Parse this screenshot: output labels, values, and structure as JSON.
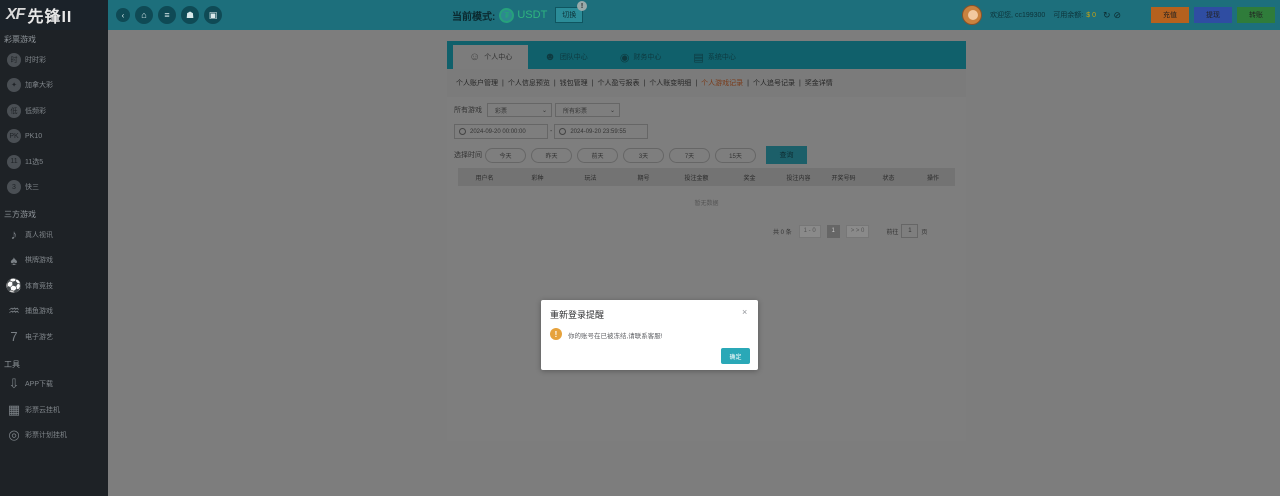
{
  "brand": {
    "logo_mark": "XF",
    "name": "先锋II"
  },
  "topbar": {
    "nav_icons": [
      "back-icon",
      "home-icon",
      "menu-icon",
      "account-icon",
      "gift-icon"
    ],
    "mode_label": "当前模式:",
    "mode_value": "USDT",
    "switch_label": "切换",
    "notice_badge": "!",
    "welcome": "欢迎您,",
    "username": "cc199300",
    "balance_label": "可用余额:",
    "balance_value": "$ 0",
    "recharge_label": "充值",
    "withdraw_label": "提现",
    "transfer_label": "转账",
    "colors": {
      "bar": "#1d6f7c",
      "recharge": "#b5611e",
      "withdraw": "#2f4da2",
      "transfer": "#2f7c3a"
    }
  },
  "sidebar": {
    "sections": [
      {
        "title": "彩票游戏",
        "items": [
          {
            "icon": "clock-icon",
            "glyph": "时",
            "label": "时时彩"
          },
          {
            "icon": "maple-leaf-icon",
            "glyph": "✦",
            "label": "加拿大彩"
          },
          {
            "icon": "low-freq-icon",
            "glyph": "低",
            "label": "低频彩"
          },
          {
            "icon": "pk10-icon",
            "glyph": "PK",
            "label": "PK10"
          },
          {
            "icon": "11x5-icon",
            "glyph": "11",
            "label": "11选5"
          },
          {
            "icon": "k3-icon",
            "glyph": "3",
            "label": "快三"
          }
        ]
      },
      {
        "title": "三方游戏",
        "items": [
          {
            "icon": "live-casino-icon",
            "glyph": "♪",
            "label": "真人视讯"
          },
          {
            "icon": "cards-icon",
            "glyph": "♠",
            "label": "棋牌游戏"
          },
          {
            "icon": "soccer-icon",
            "glyph": "⚽",
            "label": "体育竞技"
          },
          {
            "icon": "fish-icon",
            "glyph": "♒",
            "label": "捕鱼游戏"
          },
          {
            "icon": "slot-icon",
            "glyph": "7",
            "label": "电子游艺"
          }
        ]
      },
      {
        "title": "工具",
        "items": [
          {
            "icon": "download-icon",
            "glyph": "⇩",
            "label": "APP下载"
          },
          {
            "icon": "cloud-bot-icon",
            "glyph": "▦",
            "label": "彩票云挂机"
          },
          {
            "icon": "plan-bot-icon",
            "glyph": "◎",
            "label": "彩票计划挂机"
          }
        ]
      }
    ]
  },
  "panel": {
    "tabs": [
      {
        "icon": "user-icon",
        "label": "个人中心",
        "active": true
      },
      {
        "icon": "team-icon",
        "label": "团队中心",
        "active": false
      },
      {
        "icon": "finance-icon",
        "label": "财务中心",
        "active": false
      },
      {
        "icon": "system-icon",
        "label": "系统中心",
        "active": false
      }
    ],
    "subnav": [
      {
        "label": "个人账户管理",
        "active": false
      },
      {
        "label": "个人信息预览",
        "active": false
      },
      {
        "label": "钱包管理",
        "active": false
      },
      {
        "label": "个人盈亏报表",
        "active": false
      },
      {
        "label": "个人账变明细",
        "active": false
      },
      {
        "label": "个人游戏记录",
        "active": true
      },
      {
        "label": "个人追号记录",
        "active": false
      },
      {
        "label": "奖金详情",
        "active": false
      }
    ],
    "filters": {
      "game_label": "所有游戏",
      "game_type": "彩票",
      "lottery": "所有彩票",
      "date_from": "2024-09-20 00:00:00",
      "date_sep": "-",
      "date_to": "2024-09-20 23:59:55",
      "time_label": "选择时间",
      "quick_ranges": [
        "今天",
        "昨天",
        "前天",
        "3天",
        "7天",
        "15天"
      ],
      "query_label": "查询"
    },
    "table": {
      "columns": [
        "用户名",
        "彩种",
        "玩法",
        "期号",
        "投注金额",
        "奖金",
        "投注内容",
        "开奖号码",
        "状态",
        "操作"
      ],
      "empty_text": "暂无数据"
    },
    "pagination": {
      "total_text": "共 0 条",
      "prev": "1 - 0",
      "page": "1",
      "next": "> > 0",
      "goto_label": "前往",
      "goto_value": "1",
      "page_suffix": "页"
    }
  },
  "modal": {
    "title": "重新登录提醒",
    "close": "×",
    "message": "你的账号在已被冻结,请联系客服!",
    "warn_glyph": "!",
    "ok_label": "确定",
    "colors": {
      "warning": "#e6a23c",
      "ok": "#2aa8b7"
    }
  }
}
